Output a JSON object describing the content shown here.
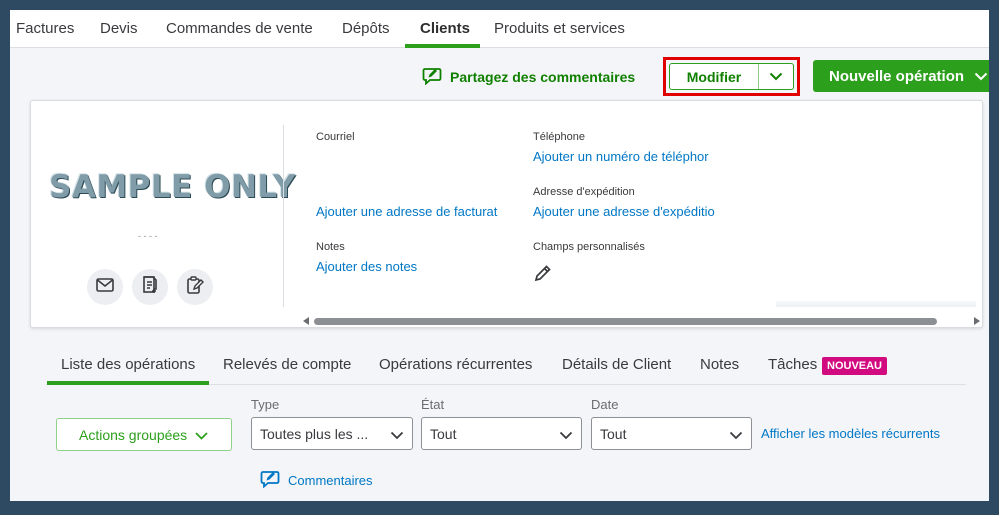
{
  "nav": {
    "tabs": [
      "Factures",
      "Devis",
      "Commandes de vente",
      "Dépôts",
      "Clients",
      "Produits et services"
    ],
    "active": "Clients"
  },
  "actions": {
    "feedback_label": "Partagez des commentaires",
    "edit_label": "Modifier",
    "new_transaction_label": "Nouvelle opération"
  },
  "customer": {
    "logo_text": "SAMPLE ONLY",
    "fields": {
      "email_label": "Courriel",
      "billing_link": "Ajouter une adresse de facturat",
      "notes_label": "Notes",
      "notes_link": "Ajouter des notes",
      "phone_label": "Téléphone",
      "phone_link": "Ajouter un numéro de téléphor",
      "shipping_label": "Adresse d'expédition",
      "shipping_link": "Ajouter une adresse d'expéditio",
      "custom_fields_label": "Champs personnalisés"
    }
  },
  "subtabs": {
    "items": [
      "Liste des opérations",
      "Relevés de compte",
      "Opérations récurrentes",
      "Détails de Client",
      "Notes",
      "Tâches"
    ],
    "badge": "NOUVEAU",
    "active": "Liste des opérations"
  },
  "filters": {
    "bulk_actions": "Actions groupées",
    "type_label": "Type",
    "type_value": "Toutes plus les ...",
    "status_label": "État",
    "status_value": "Tout",
    "date_label": "Date",
    "date_value": "Tout",
    "recurring_link": "Afficher les modèles récurrents",
    "comments_label": "Commentaires"
  },
  "colors": {
    "brand_green": "#2ca01c",
    "link_blue": "#0077c5",
    "highlight_red": "#e00000",
    "badge_magenta": "#d10a80"
  }
}
